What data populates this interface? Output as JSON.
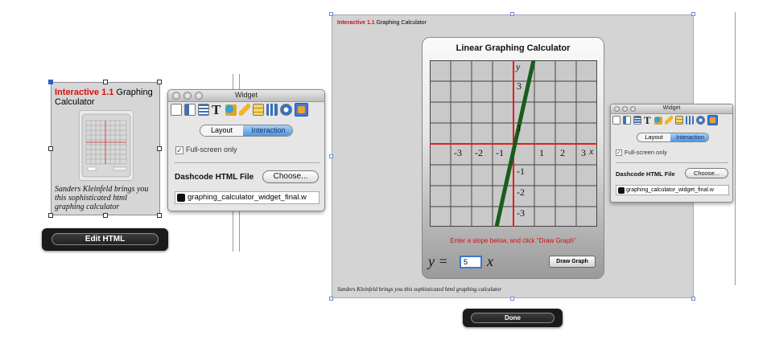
{
  "left_widget": {
    "title_prefix": "Interactive 1.1",
    "title_rest": " Graphing Calculator",
    "caption": "Sanders Kleinfeld brings you this sophisticated html graphing calculator"
  },
  "edit_html_button": {
    "label": "Edit HTML"
  },
  "inspector": {
    "window_title": "Widget",
    "tabs": [
      "Layout",
      "Interaction"
    ],
    "selected_tab": "Interaction",
    "fullscreen_label": "Full-screen only",
    "fullscreen_checked": true,
    "file_section_label": "Dashcode HTML File",
    "choose_button": "Choose...",
    "file_name": "graphing_calculator_widget_final.w"
  },
  "inspector_small": {
    "window_title": "Widget",
    "tabs": [
      "Layout",
      "Interaction"
    ],
    "fullscreen_label": "Full-screen only",
    "file_section_label": "Dashcode HTML File",
    "choose_button": "Choose...",
    "file_name": "graphing_calculator_widget_final.w"
  },
  "canvas": {
    "title_prefix": "Interactive 1.1",
    "title_rest": " Graphing Calculator",
    "caption": "Sanders Kleinfeld brings you this sophisticated html graphing calculator"
  },
  "calculator": {
    "title": "Linear Graphing Calculator",
    "y_axis_label": "y",
    "x_axis_label": "x",
    "x_ticks": [
      "-3",
      "-2",
      "-1",
      "1",
      "2",
      "3"
    ],
    "y_ticks": [
      "3",
      "1",
      "-1",
      "-2",
      "-3"
    ],
    "prompt": "Enter a slope below, and click \"Draw Graph\"",
    "equation_lhs": "y =",
    "equation_var": "x",
    "slope_value": "5",
    "draw_button": "Draw Graph"
  },
  "done_button": {
    "label": "Done"
  },
  "colors": {
    "accent_red": "#d41010",
    "axis_red": "#e02020",
    "line_green": "#1a5c1a",
    "selected_tab_blue": "#4e95de"
  },
  "icons": [
    "document-icon",
    "column-icon",
    "list-icon",
    "text-icon",
    "shapes-icon",
    "pencil-icon",
    "table-icon",
    "chart-icon",
    "quicktime-icon",
    "widget-icon"
  ]
}
